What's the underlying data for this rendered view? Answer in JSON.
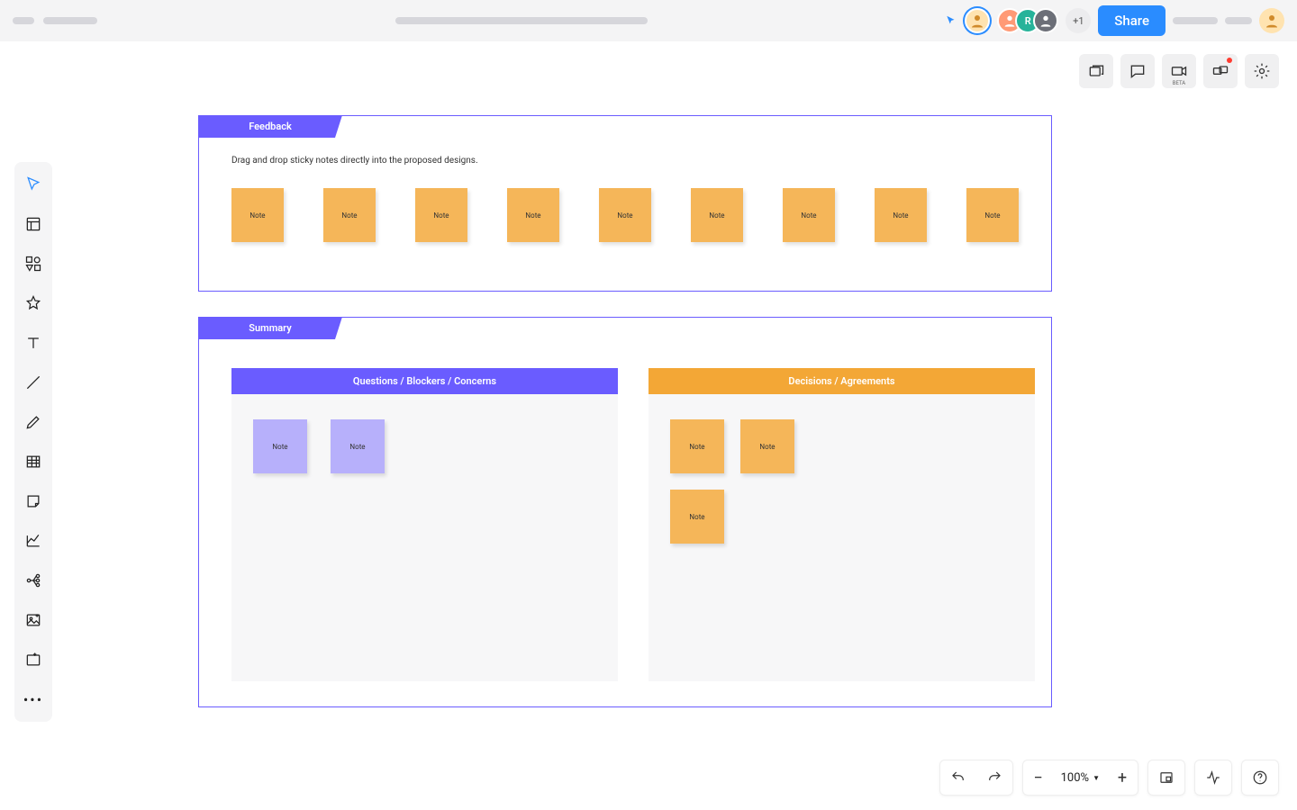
{
  "header": {
    "share_label": "Share",
    "plus_count": "+1",
    "presence": {
      "indicator": "cursor"
    },
    "avatars": [
      "U1",
      "U2",
      "R",
      "U4"
    ],
    "own_avatar": "Me"
  },
  "actionbar": {
    "beta_label": "BETA"
  },
  "toolbar": {
    "items": [
      "cursor",
      "panel",
      "shapes",
      "star",
      "text",
      "line",
      "pencil",
      "table",
      "sticky",
      "chart",
      "mindmap",
      "image",
      "frame",
      "more"
    ]
  },
  "frames": {
    "feedback": {
      "title": "Feedback",
      "instruction": "Drag and drop sticky notes directly into the proposed designs.",
      "notes": [
        "Note",
        "Note",
        "Note",
        "Note",
        "Note",
        "Note",
        "Note",
        "Note",
        "Note"
      ]
    },
    "summary": {
      "title": "Summary",
      "left": {
        "title": "Questions / Blockers / Concerns",
        "notes": [
          "Note",
          "Note"
        ]
      },
      "right": {
        "title": "Decisions / Agreements",
        "notes": [
          "Note",
          "Note",
          "Note"
        ]
      }
    }
  },
  "zoom": {
    "level": "100%"
  },
  "colors": {
    "purple": "#6a5cff",
    "orange": "#f3a736",
    "orange_note": "#f5b659",
    "lilac": "#b7b0fb",
    "blue": "#2a8cff"
  }
}
